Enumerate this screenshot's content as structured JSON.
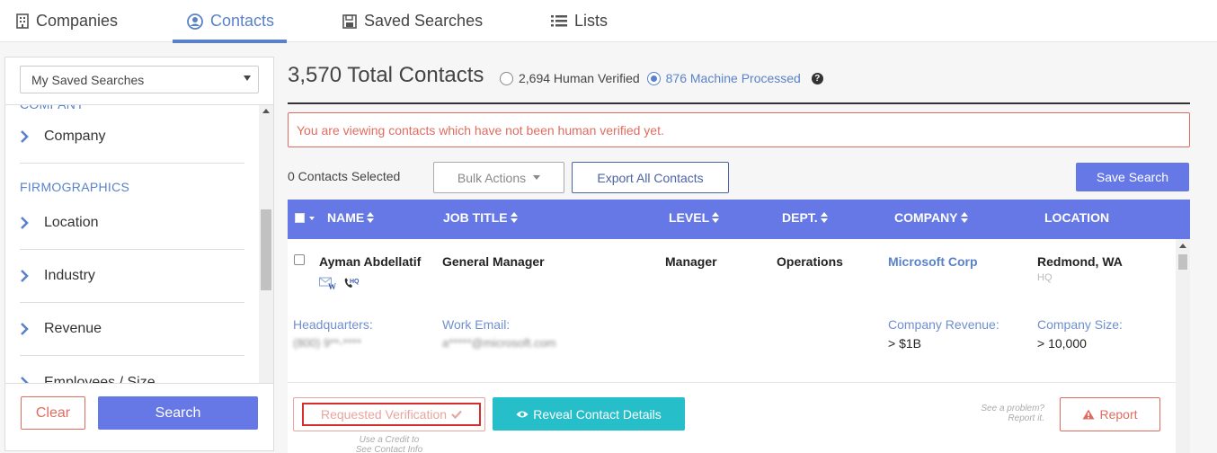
{
  "nav": {
    "tabs": [
      {
        "label": "Companies",
        "icon": "building-icon"
      },
      {
        "label": "Contacts",
        "icon": "user-circle-icon",
        "active": true
      },
      {
        "label": "Saved Searches",
        "icon": "floppy-disk-icon"
      },
      {
        "label": "Lists",
        "icon": "list-icon"
      }
    ]
  },
  "sidebar": {
    "saved_search_select": "My Saved Searches",
    "partial_top_label": "COMPANY",
    "sections": [
      {
        "label": "FIRMOGRAPHICS"
      }
    ],
    "filters": [
      "Company",
      "Location",
      "Industry",
      "Revenue",
      "Employees / Size"
    ],
    "clear_label": "Clear",
    "search_label": "Search"
  },
  "main": {
    "total_count": "3,570",
    "total_label": "Total Contacts",
    "radio_human": "2,694 Human Verified",
    "radio_machine": "876 Machine Processed",
    "help": "?",
    "alert": "You are viewing contacts which have not been human verified yet.",
    "selected": "0 Contacts Selected",
    "bulk_actions": "Bulk Actions",
    "export": "Export All Contacts",
    "save_search": "Save Search"
  },
  "table": {
    "columns": [
      "NAME",
      "JOB TITLE",
      "LEVEL",
      "DEPT.",
      "COMPANY",
      "LOCATION"
    ],
    "row": {
      "name": "Ayman Abdellatif",
      "job_title": "General Manager",
      "level": "Manager",
      "dept": "Operations",
      "company": "Microsoft Corp",
      "location": "Redmond, WA",
      "location_sub": "HQ",
      "phone_badge": "HQ",
      "email_badge": "W",
      "hq_label": "Headquarters:",
      "hq_value": "(800) 9**-****",
      "email_label": "Work Email:",
      "email_value": "a*****@microsoft.com",
      "revenue_label": "Company Revenue:",
      "revenue_value": "> $1B",
      "size_label": "Company Size:",
      "size_value": "> 10,000"
    },
    "requested_verification": "Requested Verification",
    "credit_note_1": "Use a Credit to",
    "credit_note_2": "See Contact Info",
    "reveal": "Reveal Contact Details",
    "problem_1": "See a problem?",
    "problem_2": "Report it.",
    "report": "Report"
  }
}
